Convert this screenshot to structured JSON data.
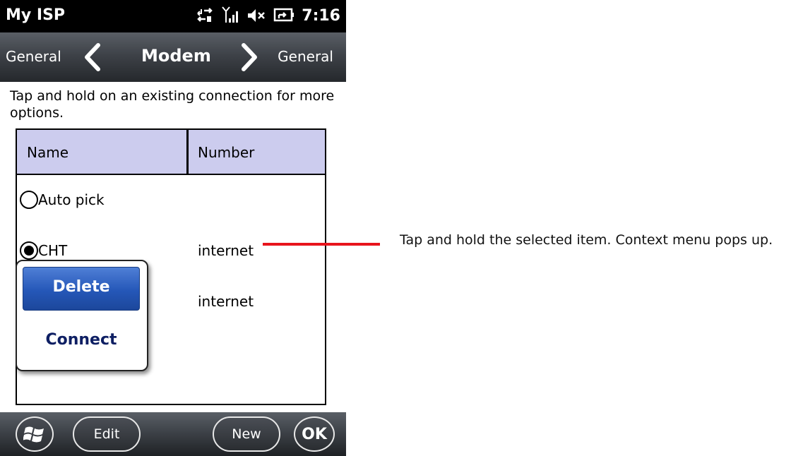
{
  "status_bar": {
    "app_title": "My ISP",
    "clock": "7:16",
    "icons": [
      "data-transfer-icon",
      "signal-icon",
      "volume-muted-icon",
      "battery-charging-icon"
    ]
  },
  "nav": {
    "prev_label": "General",
    "title": "Modem",
    "next_label": "General"
  },
  "instruction": "Tap and hold on an existing connection for more options.",
  "list": {
    "columns": [
      "Name",
      "Number"
    ],
    "rows": [
      {
        "name": "Auto pick",
        "number": "",
        "selected": false
      },
      {
        "name": "CHT",
        "number": "internet",
        "selected": true
      },
      {
        "name": "",
        "number": "internet",
        "selected": false
      }
    ]
  },
  "context_menu": {
    "items": [
      "Delete",
      "Connect"
    ],
    "highlighted": "Delete"
  },
  "bottom_bar": {
    "start_icon": "windows-logo-icon",
    "left": "Edit",
    "right": "New",
    "ok": "OK"
  },
  "annotation": {
    "text": "Tap and hold the selected item. Context menu pops up.",
    "line_color": "#e8141c"
  },
  "colors": {
    "header_row": "#ccccee",
    "menu_highlight": "#2557b8",
    "menu_text": "#0e1f63"
  }
}
